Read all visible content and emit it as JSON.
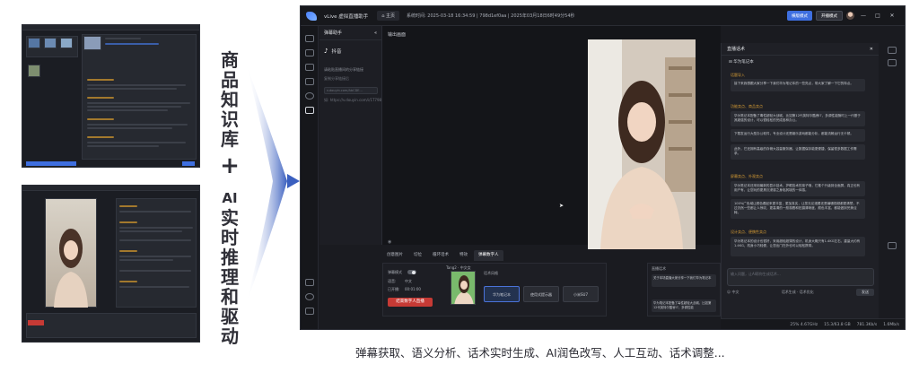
{
  "vertical_title_top": [
    "商",
    "品",
    "知",
    "识",
    "库"
  ],
  "plus": "+",
  "vertical_title_bottom": [
    "AI",
    "实",
    "时",
    "推",
    "理",
    "和",
    "驱",
    "动"
  ],
  "caption": "弹幕获取、语义分析、话术实时生成、AI润色改写、人工互动、话术调整...",
  "window": {
    "app_name": "vLive 虚拟直播助手",
    "home_label": "主页",
    "sys_info": "系统时间: 2025-03-18 16:34:59 | 798d1ef0aa | 2025年03月18日6时49分54秒",
    "btn_blue": "横版模式",
    "btn_grey": "开播模式",
    "min_icon": "—",
    "max_icon": "□",
    "close_icon": "✕"
  },
  "left_panel": {
    "title": "弹幕助手",
    "platform_icon": "♪",
    "platform": "抖音",
    "hint": "请粘贴直播间的分享链接",
    "input_placeholder": "v.douyin.com/AbCDE...",
    "line1": "复制分享链接后",
    "line2": "如: https://v.douyin.com/i/1T798"
  },
  "preview": {
    "label": "输出画面"
  },
  "tabs": [
    "创意图片",
    "切位",
    "循环话术",
    "特效",
    "弹幕数字人"
  ],
  "control": {
    "toggle_label": "弹幕模式",
    "lang_label": "语音:",
    "lang_value": "中文",
    "time_label": "已开播:",
    "time_value": "00:01:00",
    "start_button": "结束数字人直播",
    "avatar_name": "Tang2 · 中文女",
    "style_label": "话术风格",
    "styles": [
      "华为笔记本",
      "使用式提示器",
      "小米SU7"
    ]
  },
  "barrage": {
    "title": "直播话术",
    "cards": [
      "关于本场直播大家分享一下我们华为笔记本",
      "华为笔记本配备了毒性超轻大战城，比如第12代英特尔酷睿i7，多调性能"
    ]
  },
  "right_panel": {
    "title": "直播话术",
    "subtitle": "华为笔记本",
    "sections": [
      {
        "cat": "话题导入",
        "cards": [
          "接下来我想跟大家分享一下我们华为笔记本的一些亮点，带大家了解一下它的特点。"
        ]
      },
      {
        "cat": "功能卖点、商品卖点",
        "cards": [
          "华为笔记本配备了毒性超轻大战城，比如第12代英特尔酷睿i7，多调性能随时上一代基于其超强的设计，可以很轻松的完成各种办公。",
          "下载发运行大型办公软件，专业设计还是娱乐游戏都能分析，都能流畅运行无卡顿。",
          "此外，它还拥有高级的存储大容量服务器，让数据保存能更便捷，保留很多数据工作需求。"
        ]
      },
      {
        "cat": "屏幕卖点、外观卖点",
        "cards": [
          "华为笔记本还采用最新的显示技术，护眼技术的孩子哦，它推个升级到全面屏，真正也有用户有，让您玩的更具沉浸感之身临其境的一体感。",
          "100%广色域让颜色看起来更丰富，更加真实，让您无论观看还是编辑视频都更清楚，不过仍然一些都让人惊叹，更高清的一般观看和拍摄清晰度，颜色丰富，都能做到完美诠释。"
        ]
      },
      {
        "cat": "设计卖点、便携性卖点",
        "cards": [
          "华为笔记本的设计也很好，采用超轻超薄的设计，机身大概只有1.4KG左右，重量大约有1.4KG，机身小巧轻便，让您出门在外也可以轻松携带。"
        ]
      }
    ],
    "input_placeholder": "输入问题，让AI帮你生成话术...",
    "bottom_left": "☺ 中文",
    "bottom_mid": "话术生成 · 话术优化",
    "send": "发送"
  },
  "status": {
    "cpu": "25% 4.67GHz",
    "mem": "15.3/63.8 GB",
    "up": "781.3Kb/s",
    "down": "1.6Mb/s"
  }
}
